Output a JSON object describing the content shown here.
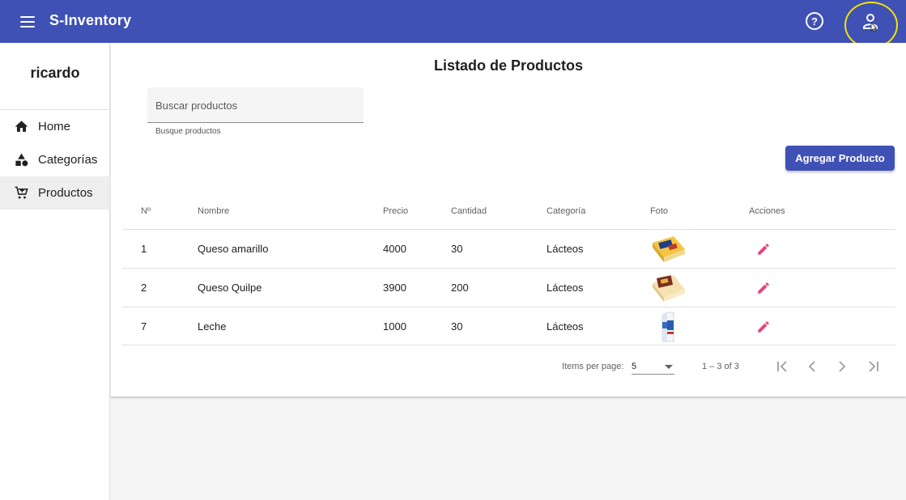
{
  "app": {
    "title": "S-Inventory"
  },
  "colors": {
    "primary": "#3f51b5",
    "edit": "#e8437a",
    "highlight": "#f2e400"
  },
  "sidebar": {
    "user_name": "ricardo",
    "items": [
      {
        "label": "Home",
        "icon": "home-icon"
      },
      {
        "label": "Categorías",
        "icon": "shapes-icon"
      },
      {
        "label": "Productos",
        "icon": "cart-icon",
        "active": true
      }
    ]
  },
  "main": {
    "title": "Listado de Productos",
    "search": {
      "placeholder": "Buscar productos",
      "value": "",
      "hint": "Busque productos"
    },
    "add_button": "Agregar Producto",
    "table": {
      "columns": [
        "Nº",
        "Nombre",
        "Precio",
        "Cantidad",
        "Categoría",
        "Foto",
        "Acciones"
      ],
      "rows": [
        {
          "no": "1",
          "nombre": "Queso amarillo",
          "precio": "4000",
          "cantidad": "30",
          "categoria": "Lácteos",
          "foto": "yellow-cheese-photo"
        },
        {
          "no": "2",
          "nombre": "Queso Quilpe",
          "precio": "3900",
          "cantidad": "200",
          "categoria": "Lácteos",
          "foto": "quilpe-cheese-photo"
        },
        {
          "no": "7",
          "nombre": "Leche",
          "precio": "1000",
          "cantidad": "30",
          "categoria": "Lácteos",
          "foto": "milk-carton-photo"
        }
      ]
    },
    "paginator": {
      "items_per_page_label": "Items per page:",
      "items_per_page": "5",
      "range": "1 – 3 of 3"
    }
  }
}
